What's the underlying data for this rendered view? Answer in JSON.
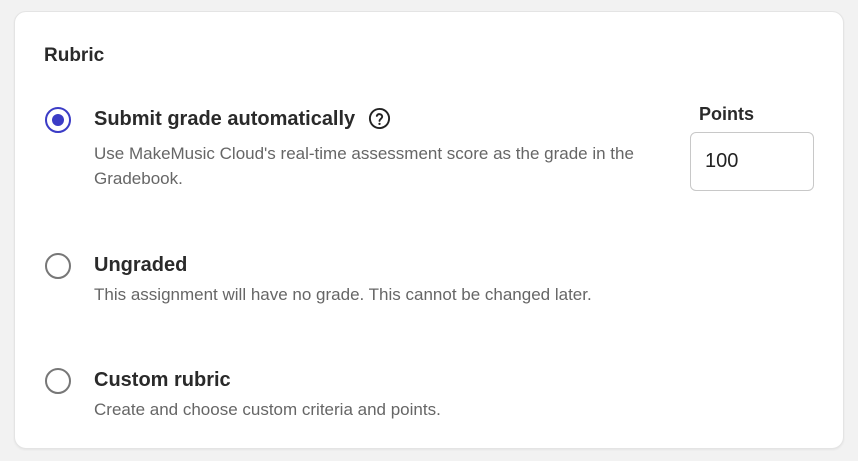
{
  "rubric": {
    "title": "Rubric",
    "options": [
      {
        "label": "Submit grade automatically",
        "description": "Use MakeMusic Cloud's real-time assessment score as the grade in the Gradebook.",
        "selected": true
      },
      {
        "label": "Ungraded",
        "description": "This assignment will have no grade. This cannot be changed later.",
        "selected": false
      },
      {
        "label": "Custom rubric",
        "description": "Create and choose custom criteria and points.",
        "selected": false
      }
    ],
    "points": {
      "label": "Points",
      "value": "100"
    }
  },
  "colors": {
    "accent": "#3b3cc6",
    "text": "#2a2a2a",
    "muted": "#666666"
  },
  "icons": {
    "help": "question-circle-icon"
  }
}
